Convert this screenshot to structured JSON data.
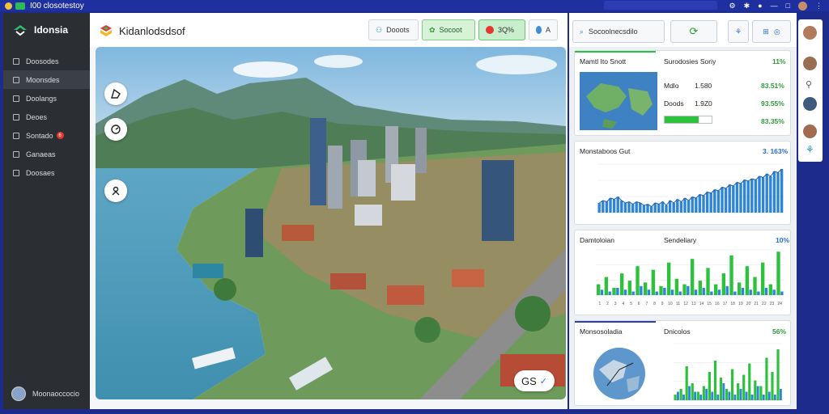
{
  "topbar": {
    "title": "I00 closotestoy"
  },
  "sidebar": {
    "brand": "Idonsia",
    "items": [
      {
        "label": "Doosodes",
        "active": false,
        "badge": ""
      },
      {
        "label": "Moonsdes",
        "active": true,
        "badge": ""
      },
      {
        "label": "Doolangs",
        "active": false,
        "badge": ""
      },
      {
        "label": "Deoes",
        "active": false,
        "badge": ""
      },
      {
        "label": "Sontado",
        "active": false,
        "badge": "6"
      },
      {
        "label": "Ganaeas",
        "active": false,
        "badge": ""
      },
      {
        "label": "Doosaes",
        "active": false,
        "badge": ""
      }
    ],
    "user": "Moonaoccocio"
  },
  "header": {
    "title": "Kidanlodsdsof",
    "btn1": "Dooots",
    "btn2": "Socoot",
    "btn3": "3Q%",
    "btn4": "A"
  },
  "map": {
    "zoom_label": "GS",
    "zoom_icon": "✓"
  },
  "right": {
    "search_label": "Socoolnecsdilo",
    "card1": {
      "title": "Mamtl Ito Snott",
      "sub": "Surodosies Soriy",
      "sub_val": "11%",
      "rows": [
        {
          "label": "Mdlo",
          "num": "1.580",
          "val": "83.51%"
        },
        {
          "label": "Doods",
          "num": "1.9Z0",
          "val": "93.55%"
        },
        {
          "label": "",
          "num": "",
          "val": "83.35%"
        }
      ],
      "progress": 0.72
    },
    "card2": {
      "title": "Monstaboos Gut",
      "val": "3. 163%"
    },
    "card3": {
      "title": "Damtoloian",
      "sub": "Sendeliary",
      "val": "10%"
    },
    "card4": {
      "title": "Monsosoladia",
      "sub": "Dnicolos",
      "val": "56%"
    }
  },
  "chart_data": [
    {
      "type": "bar",
      "title": "Monstaboos Gut",
      "values": [
        8,
        10,
        9,
        12,
        11,
        13,
        10,
        8,
        9,
        7,
        9,
        8,
        6,
        7,
        5,
        8,
        7,
        9,
        6,
        10,
        8,
        11,
        9,
        12,
        10,
        13,
        12,
        15,
        14,
        17,
        16,
        19,
        18,
        21,
        20,
        23,
        22,
        25,
        24,
        27,
        26,
        28,
        27,
        30,
        29,
        32,
        30,
        34,
        33,
        36
      ],
      "ylim": [
        0,
        40
      ]
    },
    {
      "type": "bar",
      "title": "Damtoloian",
      "categories": [
        "1",
        "2",
        "3",
        "4",
        "5",
        "6",
        "7",
        "8",
        "9",
        "10",
        "11",
        "12",
        "13",
        "14",
        "15",
        "16",
        "17",
        "18",
        "19",
        "20",
        "21",
        "22",
        "23",
        "24"
      ],
      "series": [
        {
          "name": "",
          "values": [
            6,
            10,
            4,
            12,
            8,
            16,
            7,
            14,
            5,
            18,
            9,
            6,
            20,
            8,
            15,
            6,
            12,
            22,
            7,
            16,
            10,
            18,
            6,
            24
          ]
        },
        {
          "name": "",
          "values": [
            3,
            2,
            4,
            3,
            2,
            5,
            3,
            2,
            4,
            3,
            2,
            5,
            3,
            4,
            2,
            3,
            5,
            2,
            4,
            3,
            2,
            4,
            3,
            2
          ]
        }
      ],
      "ylim": [
        0,
        25
      ]
    },
    {
      "type": "bar",
      "title": "Dnicolos",
      "series": [
        {
          "name": "",
          "values": [
            2,
            4,
            12,
            6,
            3,
            5,
            10,
            14,
            8,
            4,
            11,
            6,
            9,
            13,
            7,
            5,
            15,
            10,
            18
          ]
        },
        {
          "name": "",
          "values": [
            3,
            2,
            5,
            3,
            2,
            4,
            3,
            2,
            6,
            3,
            2,
            4,
            3,
            2,
            5,
            2,
            3,
            2,
            4
          ]
        }
      ],
      "ylim": [
        0,
        20
      ]
    }
  ]
}
